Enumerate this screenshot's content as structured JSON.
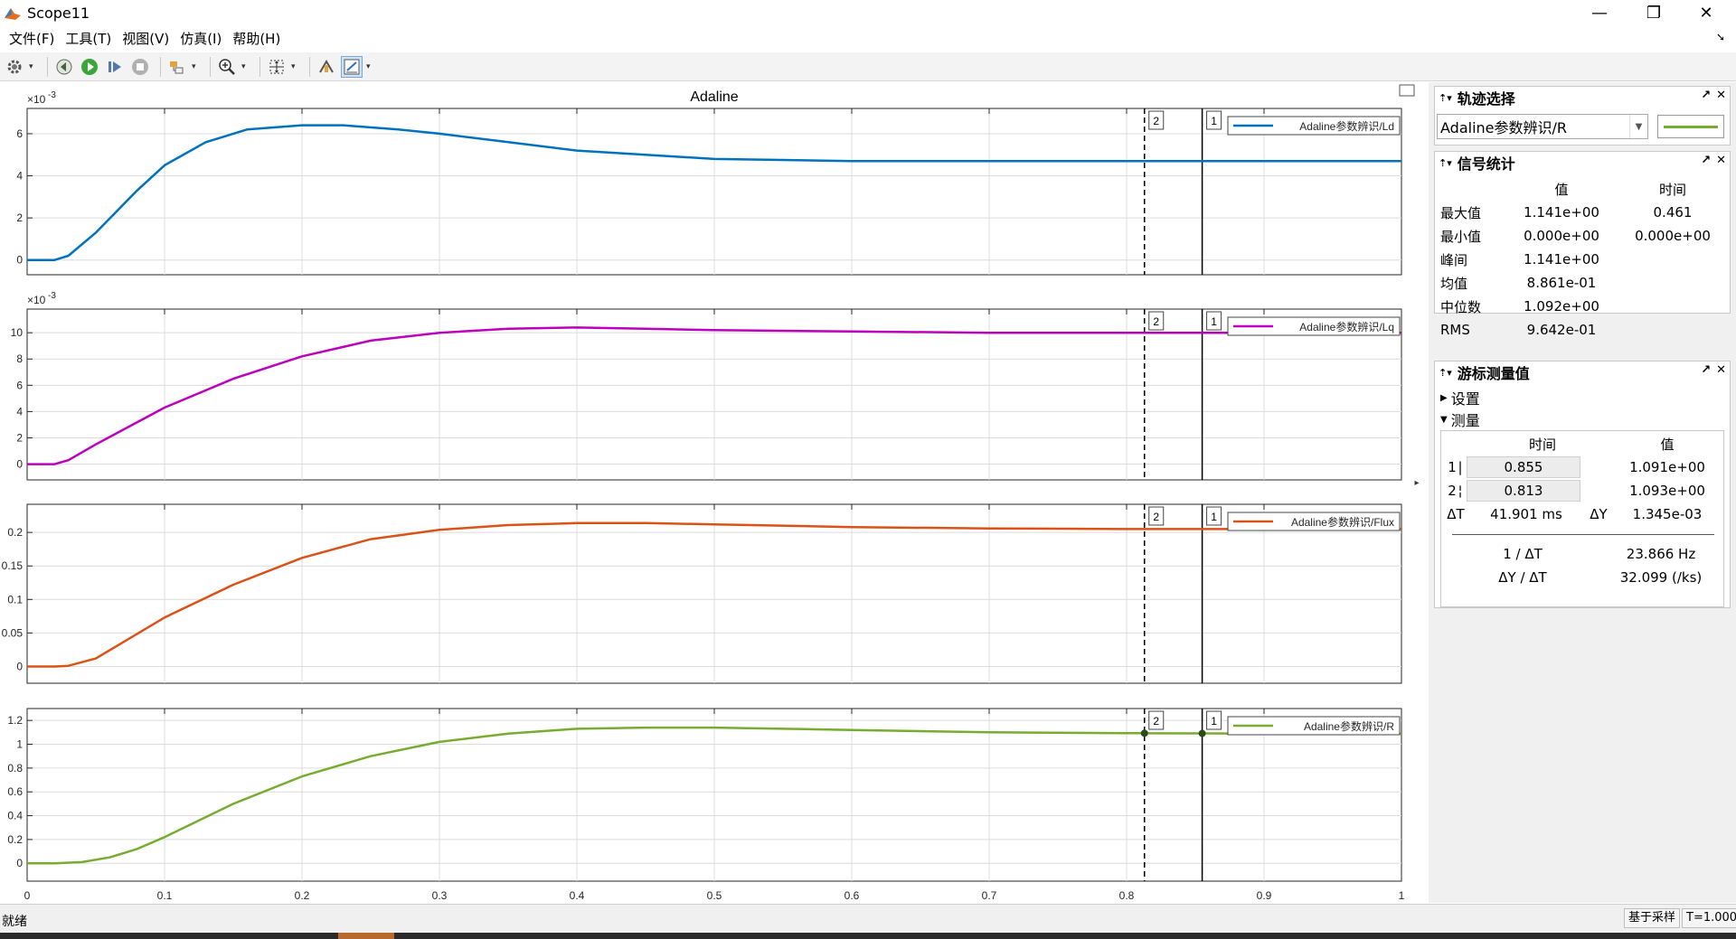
{
  "window": {
    "title": "Scope11",
    "minimize_label": "—",
    "restore_label": "❐",
    "close_label": "✕"
  },
  "menu": [
    "文件(F)",
    "工具(T)",
    "视图(V)",
    "仿真(I)",
    "帮助(H)"
  ],
  "toolbar_icons": [
    "gear-icon",
    "rewind-icon",
    "run-icon",
    "step-forward-icon",
    "stop-icon",
    "highlight-block-icon",
    "zoom-in-icon",
    "fit-to-view-icon",
    "signal-select-icon",
    "cursor-measure-icon"
  ],
  "plot": {
    "title": "Adaline",
    "x_ticks": [
      "0",
      "0.1",
      "0.2",
      "0.3",
      "0.4",
      "0.5",
      "0.6",
      "0.7",
      "0.8",
      "0.9",
      "1"
    ],
    "cursor1_label": "1",
    "cursor2_label": "2"
  },
  "chart_data": [
    {
      "type": "line",
      "series": [
        {
          "name": "Adaline参数辨识/Ld",
          "color": "#0072bd",
          "x": [
            0,
            0.02,
            0.03,
            0.05,
            0.08,
            0.1,
            0.13,
            0.16,
            0.2,
            0.23,
            0.27,
            0.3,
            0.35,
            0.4,
            0.45,
            0.5,
            0.6,
            0.7,
            0.8,
            0.9,
            1.0
          ],
          "y": [
            0.0,
            0.0,
            0.0002,
            0.0013,
            0.0033,
            0.0045,
            0.0056,
            0.0062,
            0.0064,
            0.0064,
            0.0062,
            0.006,
            0.0056,
            0.0052,
            0.005,
            0.0048,
            0.0047,
            0.0047,
            0.0047,
            0.0047,
            0.0047
          ]
        }
      ],
      "y_exponent_label": "10",
      "y_exponent": "-3",
      "y_ticks": [
        "0",
        "2",
        "4",
        "6"
      ],
      "ylim": [
        -0.0007,
        0.0072
      ],
      "xlim": [
        0,
        1
      ]
    },
    {
      "type": "line",
      "series": [
        {
          "name": "Adaline参数辨识/Lq",
          "color": "#bd00bd",
          "x": [
            0,
            0.02,
            0.03,
            0.05,
            0.1,
            0.15,
            0.2,
            0.25,
            0.3,
            0.35,
            0.4,
            0.45,
            0.5,
            0.6,
            0.7,
            0.8,
            0.9,
            1.0
          ],
          "y": [
            0.0,
            0.0,
            0.0003,
            0.0015,
            0.0043,
            0.0065,
            0.0082,
            0.0094,
            0.01,
            0.0103,
            0.0104,
            0.0103,
            0.0102,
            0.0101,
            0.01,
            0.01,
            0.01,
            0.01
          ]
        }
      ],
      "y_exponent_label": "10",
      "y_exponent": "-3",
      "y_ticks": [
        "0",
        "2",
        "4",
        "6",
        "8",
        "10"
      ],
      "ylim": [
        -0.0012,
        0.0118
      ],
      "xlim": [
        0,
        1
      ]
    },
    {
      "type": "line",
      "series": [
        {
          "name": "Adaline参数辨识/Flux",
          "color": "#d95319",
          "x": [
            0,
            0.02,
            0.03,
            0.05,
            0.1,
            0.15,
            0.2,
            0.25,
            0.3,
            0.35,
            0.4,
            0.45,
            0.5,
            0.6,
            0.7,
            0.8,
            0.9,
            1.0
          ],
          "y": [
            0.0,
            0.0,
            0.001,
            0.012,
            0.073,
            0.122,
            0.162,
            0.19,
            0.204,
            0.211,
            0.214,
            0.214,
            0.212,
            0.208,
            0.206,
            0.205,
            0.205,
            0.205
          ]
        }
      ],
      "y_ticks": [
        "0",
        "0.05",
        "0.1",
        "0.15",
        "0.2"
      ],
      "ylim": [
        -0.025,
        0.242
      ],
      "xlim": [
        0,
        1
      ]
    },
    {
      "type": "line",
      "series": [
        {
          "name": "Adaline参数辨识/R",
          "color": "#77ac30",
          "x": [
            0,
            0.02,
            0.04,
            0.06,
            0.08,
            0.1,
            0.15,
            0.2,
            0.25,
            0.3,
            0.35,
            0.4,
            0.45,
            0.5,
            0.6,
            0.7,
            0.8,
            0.813,
            0.855,
            0.9,
            1.0
          ],
          "y": [
            0.0,
            0.0,
            0.01,
            0.05,
            0.12,
            0.22,
            0.5,
            0.73,
            0.9,
            1.02,
            1.09,
            1.13,
            1.14,
            1.14,
            1.12,
            1.1,
            1.093,
            1.093,
            1.091,
            1.09,
            1.09
          ]
        }
      ],
      "y_ticks": [
        "0",
        "0.2",
        "0.4",
        "0.6",
        "0.8",
        "1",
        "1.2"
      ],
      "ylim": [
        -0.15,
        1.3
      ],
      "xlim": [
        0,
        1
      ]
    }
  ],
  "trace_selection": {
    "title": "轨迹选择",
    "selected": "Adaline参数辨识/R",
    "line_color": "#77ac30"
  },
  "signal_stats": {
    "title": "信号统计",
    "col_value": "值",
    "col_time": "时间",
    "rows": [
      {
        "label": "最大值",
        "value": "1.141e+00",
        "time": "0.461"
      },
      {
        "label": "最小值",
        "value": "0.000e+00",
        "time": "0.000e+00"
      },
      {
        "label": "峰间",
        "value": "1.141e+00",
        "time": ""
      },
      {
        "label": "均值",
        "value": "8.861e-01",
        "time": ""
      },
      {
        "label": "中位数",
        "value": "1.092e+00",
        "time": ""
      },
      {
        "label": "RMS",
        "value": "9.642e-01",
        "time": ""
      }
    ]
  },
  "cursor_measure": {
    "title": "游标测量值",
    "settings_label": "设置",
    "measure_label": "测量",
    "col_time": "时间",
    "col_value": "值",
    "c1_label": "1",
    "c1_time": "0.855",
    "c1_value": "1.091e+00",
    "c2_label": "2",
    "c2_time": "0.813",
    "c2_value": "1.093e+00",
    "dt_label": "ΔT",
    "dt_value": "41.901 ms",
    "dy_label": "ΔY",
    "dy_value": "1.345e-03",
    "inv_dt_label": "1 / ΔT",
    "inv_dt_value": "23.866 Hz",
    "dydt_label": "ΔY / ΔT",
    "dydt_value": "32.099 (/ks)"
  },
  "status": {
    "ready": "就绪",
    "mode": "基于采样",
    "time": "T=1.000"
  }
}
